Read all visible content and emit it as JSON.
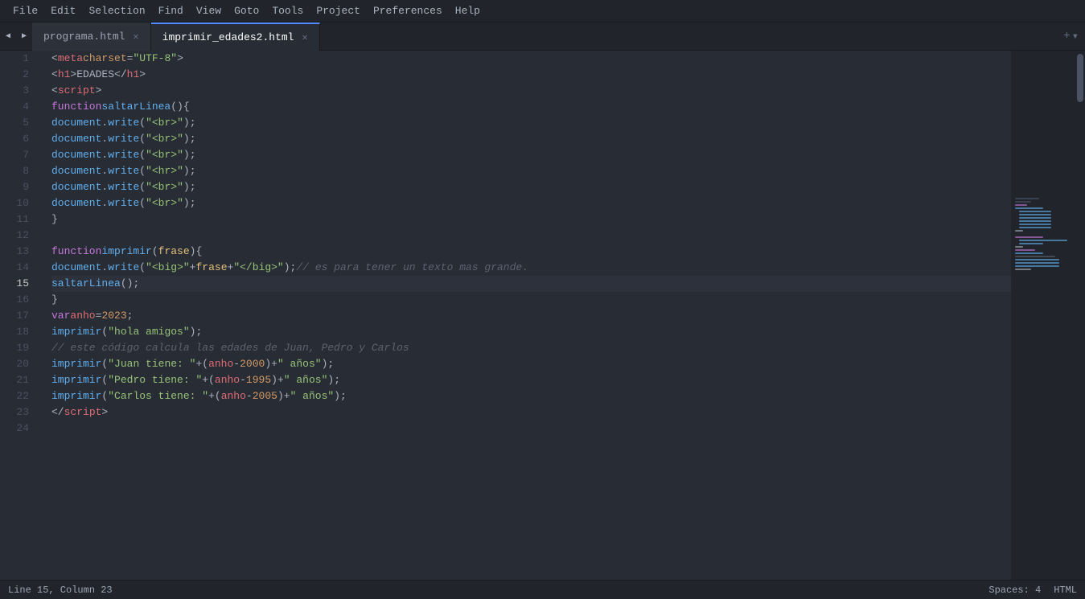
{
  "menubar": {
    "items": [
      "File",
      "Edit",
      "Selection",
      "Find",
      "View",
      "Goto",
      "Tools",
      "Project",
      "Preferences",
      "Help"
    ]
  },
  "tabs": [
    {
      "id": "tab1",
      "label": "programa.html",
      "active": false
    },
    {
      "id": "tab2",
      "label": "imprimir_edades2.html",
      "active": true
    }
  ],
  "editor": {
    "filename": "imprimir_edades2.html",
    "active_line": 15,
    "lines": [
      {
        "num": 1,
        "html": "<span class='plain'>&lt;</span><span class='tag'>meta</span> <span class='attr-name'>charset</span><span class='plain'>=</span><span class='attr-value'>\"UTF-8\"</span><span class='plain'>&gt;</span>"
      },
      {
        "num": 2,
        "html": "<span class='plain'>&lt;</span><span class='tag'>h1</span><span class='plain'>&gt;EDADES&lt;/</span><span class='tag'>h1</span><span class='plain'>&gt;</span>"
      },
      {
        "num": 3,
        "html": "<span class='plain'>&lt;</span><span class='tag'>script</span><span class='plain'>&gt;</span>"
      },
      {
        "num": 4,
        "html": "    <span class='kw'>function</span> <span class='fn-name'>saltarLinea</span><span class='paren'>()</span> <span class='plain'>{</span>"
      },
      {
        "num": 5,
        "html": "        <span class='method'>document</span><span class='plain'>.</span><span class='fn-name'>write</span><span class='paren'>(</span><span class='string'>\"&lt;br&gt;\"</span><span class='paren'>)</span><span class='plain'>;</span>"
      },
      {
        "num": 6,
        "html": "        <span class='method'>document</span><span class='plain'>.</span><span class='fn-name'>write</span><span class='paren'>(</span><span class='string'>\"&lt;br&gt;\"</span><span class='paren'>)</span><span class='plain'>;</span>"
      },
      {
        "num": 7,
        "html": "        <span class='method'>document</span><span class='plain'>.</span><span class='fn-name'>write</span><span class='paren'>(</span><span class='string'>\"&lt;br&gt;\"</span><span class='paren'>)</span><span class='plain'>;</span>"
      },
      {
        "num": 8,
        "html": "        <span class='method'>document</span><span class='plain'>.</span><span class='fn-name'>write</span><span class='paren'>(</span><span class='string'>\"&lt;hr&gt;\"</span><span class='paren'>)</span><span class='plain'>;</span>"
      },
      {
        "num": 9,
        "html": "        <span class='method'>document</span><span class='plain'>.</span><span class='fn-name'>write</span><span class='paren'>(</span><span class='string'>\"&lt;br&gt;\"</span><span class='paren'>)</span><span class='plain'>;</span>"
      },
      {
        "num": 10,
        "html": "        <span class='method'>document</span><span class='plain'>.</span><span class='fn-name'>write</span><span class='paren'>(</span><span class='string'>\"&lt;br&gt;\"</span><span class='paren'>)</span><span class='plain'>;</span>"
      },
      {
        "num": 11,
        "html": "    <span class='plain'>}</span>"
      },
      {
        "num": 12,
        "html": ""
      },
      {
        "num": 13,
        "html": "    <span class='kw'>function</span> <span class='fn-name'>imprimir</span><span class='paren'>(</span><span class='param'>frase</span><span class='paren'>)</span> <span class='plain'>{</span>"
      },
      {
        "num": 14,
        "html": "        <span class='method'>document</span><span class='plain'>.</span><span class='fn-name'>write</span><span class='paren'>(</span><span class='string'>\"&lt;big&gt;\"</span><span class='plain'>+</span><span class='param'>frase</span><span class='plain'>+</span><span class='string'>\"&lt;/big&gt;\"</span><span class='paren'>)</span><span class='plain'>;</span><span class='comment'>// es para tener un texto mas grande.</span>"
      },
      {
        "num": 15,
        "html": "        <span class='fn-name'>saltarLinea</span><span class='paren'>()</span><span class='plain'>;</span>"
      },
      {
        "num": 16,
        "html": "    <span class='plain'>}</span>"
      },
      {
        "num": 17,
        "html": "    <span class='var-kw'>var</span> <span class='var-name'>anho</span> <span class='operator'>=</span> <span class='number'>2023</span><span class='plain'>;</span>"
      },
      {
        "num": 18,
        "html": "    <span class='fn-name'>imprimir</span><span class='paren'>(</span><span class='string'>\"hola amigos\"</span><span class='paren'>)</span><span class='plain'>;</span>"
      },
      {
        "num": 19,
        "html": "    <span class='comment'>// este código calcula las edades de Juan, Pedro y Carlos</span>"
      },
      {
        "num": 20,
        "html": "    <span class='fn-name'>imprimir</span><span class='paren'>(</span><span class='string'>\"Juan tiene: \"</span> <span class='operator'>+</span> <span class='paren'>(</span><span class='var-name'>anho</span><span class='operator'>-</span><span class='number'>2000</span><span class='paren'>)</span> <span class='operator'>+</span> <span class='string'>\" años\"</span><span class='paren'>)</span><span class='plain'>;</span>"
      },
      {
        "num": 21,
        "html": "    <span class='fn-name'>imprimir</span><span class='paren'>(</span><span class='string'>\"Pedro tiene: \"</span> <span class='operator'>+</span> <span class='paren'>(</span><span class='var-name'>anho</span><span class='operator'>-</span><span class='number'>1995</span><span class='paren'>)</span> <span class='operator'>+</span> <span class='string'>\" años\"</span><span class='paren'>)</span><span class='plain'>;</span>"
      },
      {
        "num": 22,
        "html": "    <span class='fn-name'>imprimir</span><span class='paren'>(</span><span class='string'>\"Carlos tiene: \"</span> <span class='operator'>+</span> <span class='paren'>(</span><span class='var-name'>anho</span><span class='operator'>-</span><span class='number'>2005</span><span class='paren'>)</span> <span class='operator'>+</span> <span class='string'>\" años\"</span><span class='paren'>)</span><span class='plain'>;</span>"
      },
      {
        "num": 23,
        "html": "<span class='plain'>&lt;/</span><span class='tag'>script</span><span class='plain'>&gt;</span>"
      },
      {
        "num": 24,
        "html": ""
      }
    ]
  },
  "statusbar": {
    "position": "Line 15, Column 23",
    "spaces": "Spaces: 4",
    "language": "HTML"
  }
}
